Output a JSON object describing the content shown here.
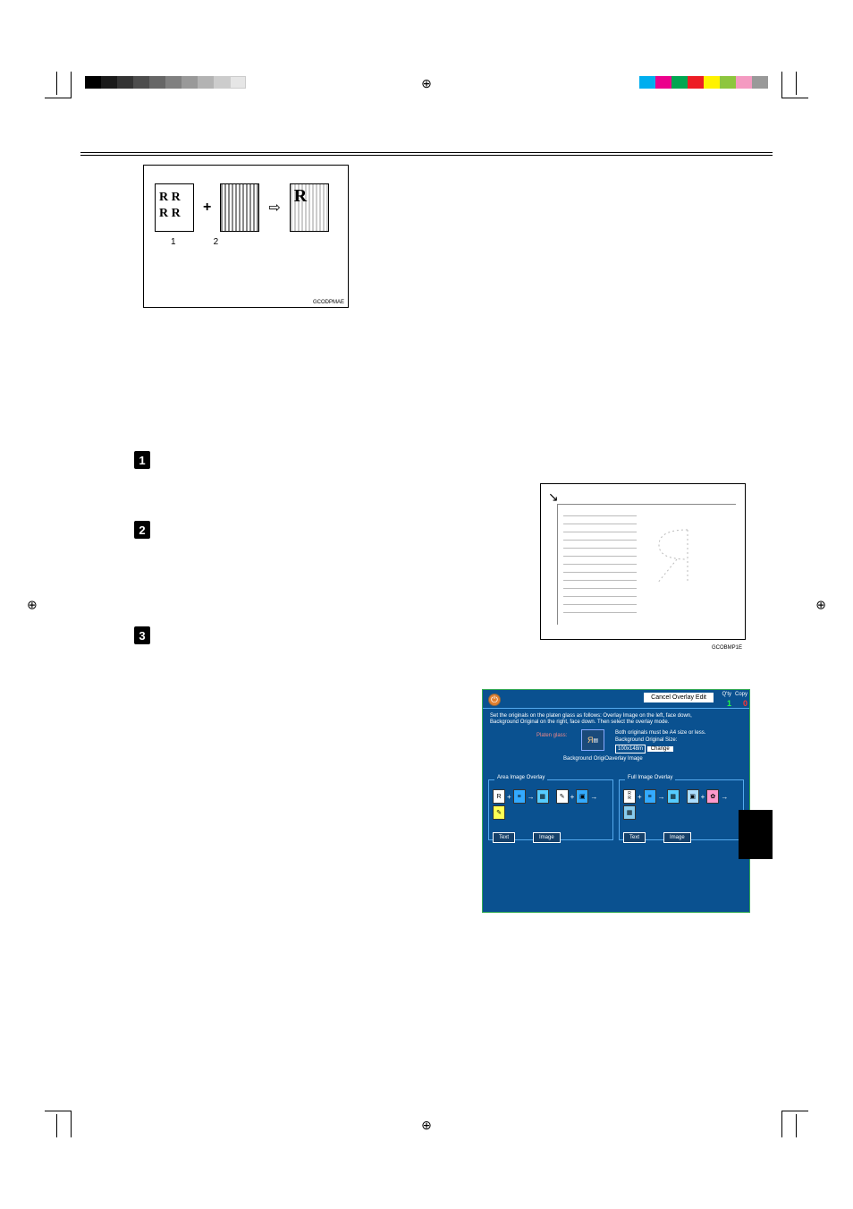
{
  "diagram1": {
    "box1_text": "R R\nR R",
    "plus": "+",
    "arrow": "⇨",
    "box3_letter": "R",
    "label1": "1",
    "label2": "2",
    "caption": "GCODPMAE"
  },
  "steps": {
    "s1": "1",
    "s2": "2",
    "s3": "3"
  },
  "diagram2": {
    "corner": "↘",
    "caption": "GCOBMP1E"
  },
  "screenshot": {
    "cancel": "Cancel Overlay Edit",
    "qty_label": "Q'ty",
    "qty_value": "1",
    "copy_label": "Copy",
    "copy_value": "0",
    "instructions_line1": "Set the originals on the platen glass as follows: Overlay Image on the left, face down,",
    "instructions_line2": "Background Original on the right, face down. Then select the overlay mode.",
    "platen_label": "Platen glass:",
    "bg_label_line1": "Both originals must be A4 size or less.",
    "bg_label_line2": "Background Original Size:",
    "bg_size": "100x148m",
    "change": "Change",
    "below_label": "Background OrigiOaverlay Image",
    "group1_title": "Area Image Overlay",
    "group2_title": "Full Image Overlay",
    "btn_text": "Text",
    "btn_image": "Image",
    "icon_R": "R",
    "icon_RR": "R\nR",
    "power_icon": "⏻"
  },
  "colorbar": [
    "#00aeef",
    "#ec008c",
    "#00a651",
    "#ed1c24",
    "#fff200",
    "#8dc63e",
    "#f49ac1",
    "#999"
  ],
  "grayscale": [
    "#000",
    "#1a1a1a",
    "#333",
    "#4d4d4d",
    "#666",
    "#808080",
    "#999",
    "#b3b3b3",
    "#ccc",
    "#e6e6e6",
    "#fff"
  ]
}
